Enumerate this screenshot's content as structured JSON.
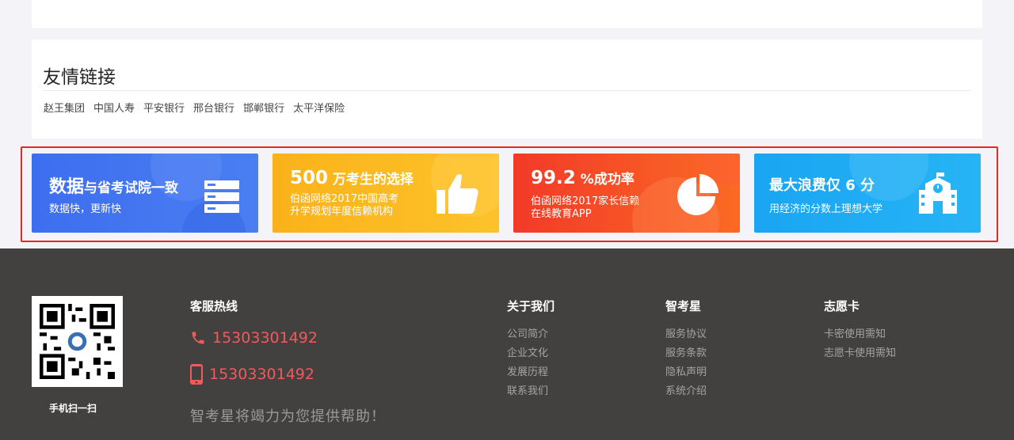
{
  "friend_links": {
    "title": "友情链接",
    "items": [
      "赵王集团",
      "中国人寿",
      "平安银行",
      "邢台银行",
      "邯郸银行",
      "太平洋保险"
    ]
  },
  "banners": [
    {
      "title_big": "数据",
      "title_rest": "与省考试院一致",
      "sub1": "数据快，更新快",
      "sub2": "",
      "icon": "server-icon",
      "color": "#3d6eef"
    },
    {
      "title_big": "500",
      "title_rest": " 万考生的选择",
      "sub1": "伯函网络2017中国高考",
      "sub2": "升学规划年度信赖机构",
      "icon": "thumbs-up-icon",
      "color": "#fbb21a"
    },
    {
      "title_big": "99.2",
      "title_rest": " %成功率",
      "sub1": "伯函网络2017家长信赖",
      "sub2": "在线教育APP",
      "icon": "pie-chart-icon",
      "color": "#f23a28"
    },
    {
      "title_big": "最大浪费仅 6 分",
      "title_rest": "",
      "sub1": "用经济的分数上理想大学",
      "sub2": "",
      "icon": "school-building-icon",
      "color": "#19a5f2"
    }
  ],
  "footer": {
    "qr_caption": "手机扫一扫",
    "hotline_title": "客服热线",
    "phone1": "15303301492",
    "phone2": "15303301492",
    "slogan": "智考星将竭力为您提供帮助！",
    "columns": [
      {
        "title": "关于我们",
        "items": [
          "公司简介",
          "企业文化",
          "发展历程",
          "联系我们"
        ]
      },
      {
        "title": "智考星",
        "items": [
          "服务协议",
          "服务条款",
          "隐私声明",
          "系统介绍"
        ]
      },
      {
        "title": "志愿卡",
        "items": [
          "卡密使用需知",
          "志愿卡使用需知"
        ]
      }
    ]
  },
  "colors": {
    "accent_red": "#f05a5a",
    "footer_bg": "#434140",
    "highlight_border": "#e8281e"
  }
}
